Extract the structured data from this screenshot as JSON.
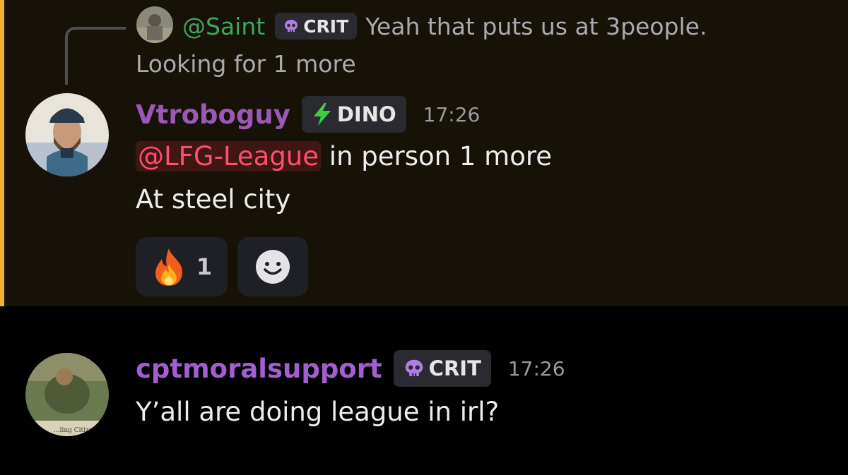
{
  "reply": {
    "username": "@Saint",
    "badge": "CRIT",
    "text_line1": "Yeah that puts us at 3people.",
    "text_line2": "Looking for 1 more"
  },
  "message1": {
    "username": "Vtroboguy",
    "badge": "DINO",
    "timestamp": "17:26",
    "mention": "@LFG-League",
    "line1_rest": " in person 1 more",
    "line2": "At steel city",
    "reactions": [
      {
        "emoji": "fire-icon",
        "count": "1"
      },
      {
        "emoji": "add-reaction-icon"
      }
    ]
  },
  "message2": {
    "username": "cptmoralsupport",
    "badge": "CRIT",
    "timestamp": "17:26",
    "text": "Y’all are doing league in irl?",
    "avatar_caption": "...ling Citizen"
  },
  "colors": {
    "highlight_bg": "#161207",
    "highlight_bar": "#f0b232",
    "username_purple": "#9b59b6",
    "reply_green": "#3fa55c",
    "mention_red": "#ff4d6d"
  }
}
